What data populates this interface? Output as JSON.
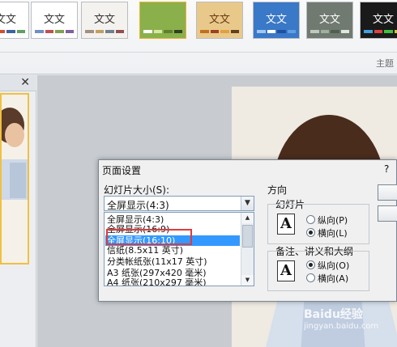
{
  "ribbon": {
    "group_label": "主题",
    "themes": [
      {
        "text": "文文",
        "bg": "#ffffff",
        "fg": "#333333",
        "bars": [
          "#e8a040",
          "#d05030",
          "#4060a0",
          "#60a060"
        ]
      },
      {
        "text": "文文",
        "bg": "#ffffff",
        "fg": "#333333",
        "bars": [
          "#7090c0",
          "#c05050",
          "#80a050",
          "#8060a0"
        ]
      },
      {
        "text": "文文",
        "bg": "#f4f2ee",
        "fg": "#333333",
        "bars": [
          "#a09080",
          "#c0a060",
          "#708090",
          "#905050"
        ]
      },
      {
        "text": "",
        "bg": "#8ab04c",
        "fg": "#ffffff",
        "bars": [
          "#ffffff",
          "#d8e8a0",
          "#608030",
          "#304020"
        ]
      },
      {
        "text": "文文",
        "bg": "#e9c98a",
        "fg": "#6a3a10",
        "bars": [
          "#c07020",
          "#a04020",
          "#e0a040",
          "#604020"
        ]
      },
      {
        "text": "文文",
        "bg": "#3a78c8",
        "fg": "#ffffff",
        "bars": [
          "#a0c8f0",
          "#ffffff",
          "#2050a0",
          "#60a0e0"
        ]
      },
      {
        "text": "文文",
        "bg": "#707a70",
        "fg": "#ffffff",
        "bars": [
          "#c0c8c0",
          "#a0b0a0",
          "#506050",
          "#e0e8e0"
        ]
      },
      {
        "text": "文文",
        "bg": "#1a1a1a",
        "fg": "#ffffff",
        "bars": [
          "#40a0e0",
          "#e04040",
          "#40c040",
          "#e0c040"
        ]
      }
    ]
  },
  "pane": {
    "close_glyph": "✕"
  },
  "dialog": {
    "title": "页面设置",
    "help": "?",
    "size_label": "幻灯片大小(S):",
    "size_value": "全屏显示(4:3)",
    "size_options": [
      "全屏显示(4:3)",
      "全屏显示(16:9)",
      "全屏显示(16:10)",
      "信纸(8.5x11 英寸)",
      "分类帐纸张(11x17 英寸)",
      "A3 纸张(297x420 毫米)",
      "A4 纸张(210x297 毫米)"
    ],
    "selected_index": 2,
    "orientation_label": "方向",
    "slides_label": "幻灯片",
    "notes_label": "备注、讲义和大纲",
    "portrait_slides": "纵向(P)",
    "landscape_slides": "横向(L)",
    "portrait_notes": "纵向(O)",
    "landscape_notes": "横向(A)",
    "slides_orientation": "landscape",
    "notes_orientation": "portrait",
    "paper_icon_glyph": "A"
  },
  "watermark": {
    "main": "Baidu经验",
    "sub": "jingyan.baidu.com"
  }
}
